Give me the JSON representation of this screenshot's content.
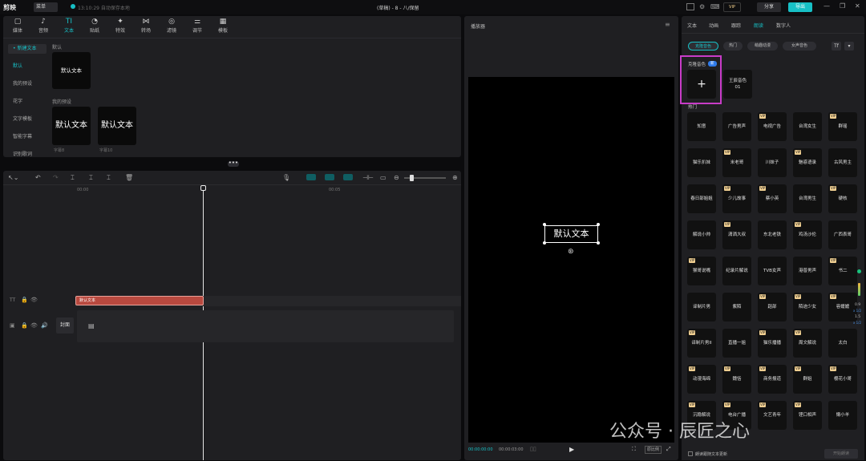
{
  "titlebar": {
    "app_name": "剪映",
    "menu_label": "菜单",
    "autosave_status": "13:10:29 自动保存本地",
    "project_title": "(草稿) - 8 - 八/保留",
    "vip_label": "VIP",
    "share_label": "分享",
    "export_label": "导出"
  },
  "toolbar": {
    "items": [
      {
        "label": "媒体",
        "icon": "media-icon"
      },
      {
        "label": "音频",
        "icon": "audio-icon"
      },
      {
        "label": "文本",
        "icon": "text-icon"
      },
      {
        "label": "贴纸",
        "icon": "sticker-icon"
      },
      {
        "label": "特效",
        "icon": "effect-icon"
      },
      {
        "label": "转场",
        "icon": "transition-icon"
      },
      {
        "label": "滤镜",
        "icon": "filter-icon"
      },
      {
        "label": "调节",
        "icon": "adjust-icon"
      },
      {
        "label": "模板",
        "icon": "template-icon"
      }
    ]
  },
  "sidebar": {
    "items": [
      "• 新建文本",
      "默认",
      "我的预设",
      "花字",
      "文字模板",
      "智能字幕",
      "识别歌词"
    ]
  },
  "media": {
    "default_section": "默认",
    "default_tile": "默认文本",
    "my_presets_section": "我的预设",
    "presets": [
      {
        "text": "默认文本",
        "caption": "字幕8"
      },
      {
        "text": "默认文本",
        "caption": "字幕10"
      }
    ]
  },
  "timeline": {
    "ruler": [
      "00:00",
      "00:05"
    ],
    "text_clip_label": "默认文本",
    "cover_label": "封面"
  },
  "player": {
    "title": "播放器",
    "caption_text": "默认文本",
    "time_current": "00:00:00:00",
    "time_total": "00:00:03:00",
    "ratio_label": "原比例"
  },
  "right_panel": {
    "tabs": [
      "文本",
      "动画",
      "跟踪",
      "朗读",
      "数字人"
    ],
    "selected_tab": "朗读",
    "chips": [
      "克隆音色",
      "热门",
      "萌趣动漫",
      "女声音色"
    ],
    "clone_section": "克隆音色",
    "clone_badge": "新",
    "my_clone_label": "王辰音色01",
    "hot_section": "热门",
    "voices": [
      {
        "name": "知意",
        "vip": false
      },
      {
        "name": "广告男声",
        "vip": false
      },
      {
        "name": "电视广告",
        "vip": true
      },
      {
        "name": "台湾女生",
        "vip": false
      },
      {
        "name": "群瑶",
        "vip": true
      },
      {
        "name": "猫乐扒妹",
        "vip": false
      },
      {
        "name": "米老哥",
        "vip": true
      },
      {
        "name": "川妹子",
        "vip": false
      },
      {
        "name": "魅惑语录",
        "vip": true
      },
      {
        "name": "古风男主",
        "vip": false
      },
      {
        "name": "春日部姐姐",
        "vip": false
      },
      {
        "name": "少儿故事",
        "vip": true
      },
      {
        "name": "蔡小英",
        "vip": true
      },
      {
        "name": "台湾男生",
        "vip": false
      },
      {
        "name": "硬核",
        "vip": true
      },
      {
        "name": "解说小帅",
        "vip": false
      },
      {
        "name": "潇洒大叔",
        "vip": true
      },
      {
        "name": "东北老铁",
        "vip": false
      },
      {
        "name": "鸡汤沙伦",
        "vip": true
      },
      {
        "name": "广西表哥",
        "vip": false
      },
      {
        "name": "猴哥说嘴",
        "vip": true
      },
      {
        "name": "纪录片解说",
        "vip": false
      },
      {
        "name": "TVB女声",
        "vip": false
      },
      {
        "name": "港普男声",
        "vip": false
      },
      {
        "name": "书二",
        "vip": true
      },
      {
        "name": "译制片男",
        "vip": false
      },
      {
        "name": "紫陌",
        "vip": false
      },
      {
        "name": "蹈部",
        "vip": true
      },
      {
        "name": "陌迹少女",
        "vip": true
      },
      {
        "name": "容嬷嬷",
        "vip": true
      },
      {
        "name": "译制片男II",
        "vip": true
      },
      {
        "name": "直播一姐",
        "vip": false
      },
      {
        "name": "猫乐播播",
        "vip": true
      },
      {
        "name": "周文解说",
        "vip": true
      },
      {
        "name": "太白",
        "vip": false
      },
      {
        "name": "动漫海绵",
        "vip": true
      },
      {
        "name": "魏恬",
        "vip": true
      },
      {
        "name": "商务报道",
        "vip": true
      },
      {
        "name": "群姐",
        "vip": true
      },
      {
        "name": "樱花小哥",
        "vip": true
      },
      {
        "name": "沉稳解说",
        "vip": true
      },
      {
        "name": "电台广播",
        "vip": true
      },
      {
        "name": "文艺青年",
        "vip": true
      },
      {
        "name": "铿口相声",
        "vip": true
      },
      {
        "name": "懒小羊",
        "vip": false
      }
    ],
    "footer_checkbox": "朗读跟随文本更新",
    "footer_button": "开始朗读",
    "level_labels": [
      "0.9",
      "x 1/2",
      "1.5",
      "x 1/2"
    ]
  },
  "watermark": "公众号 · 辰匠之心",
  "colors": {
    "accent": "#17c0c6",
    "highlight": "#c83cc8",
    "clip": "#b8493f",
    "vip": "#f0cf91"
  }
}
